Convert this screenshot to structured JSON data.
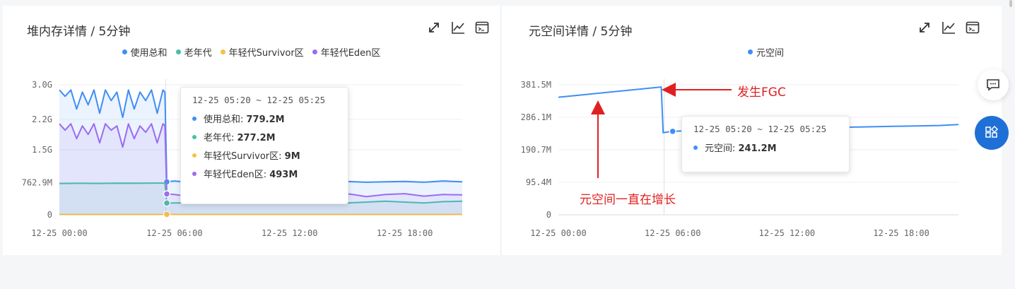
{
  "heap_panel": {
    "title": "堆内存详情 / 5分钟",
    "tooltip": {
      "time": "12-25 05:20 ~ 12-25 05:25",
      "rows": [
        {
          "label": "使用总和:",
          "value": "779.2M",
          "color": "#3f8ef5"
        },
        {
          "label": "老年代:",
          "value": "277.2M",
          "color": "#45c1a4"
        },
        {
          "label": "年轻代Survivor区:",
          "value": "9M",
          "color": "#f5c242"
        },
        {
          "label": "年轻代Eden区:",
          "value": "493M",
          "color": "#9b6cf0"
        }
      ]
    }
  },
  "meta_panel": {
    "title": "元空间详情 / 5分钟",
    "tooltip": {
      "time": "12-25 05:20 ~ 12-25 05:25",
      "rows": [
        {
          "label": "元空间:",
          "value": "241.2M",
          "color": "#3f8ef5"
        }
      ]
    }
  },
  "annotations": {
    "fgc": "发生FGC",
    "growth": "元空间一直在增长"
  },
  "icons": [
    "expand-icon",
    "line-chart-icon",
    "console-icon",
    "comment-icon",
    "apps-icon"
  ],
  "chart_data": [
    {
      "type": "line",
      "title": "堆内存详情 / 5分钟",
      "x_ticks": [
        "12-25 00:00",
        "12-25 06:00",
        "12-25 12:00",
        "12-25 18:00"
      ],
      "y_ticks": [
        "3.0G",
        "2.2G",
        "1.5G",
        "762.9M",
        "0"
      ],
      "y_tick_values_mb": [
        3072,
        2253,
        1536,
        762.9,
        0
      ],
      "ylim_mb": [
        0,
        3072
      ],
      "x_unit": "hours since 12-25 00:00",
      "xlim": [
        0,
        21
      ],
      "legend_position": "top",
      "grid": true,
      "series": [
        {
          "name": "使用总和",
          "color": "#3f8ef5",
          "x": [
            0,
            0.3,
            0.6,
            0.9,
            1.2,
            1.5,
            1.8,
            2.1,
            2.4,
            2.7,
            3.0,
            3.3,
            3.6,
            3.9,
            4.2,
            4.5,
            4.8,
            5.1,
            5.4,
            5.5,
            5.6,
            6,
            7,
            8,
            9,
            10,
            11,
            12,
            13,
            14,
            15,
            16,
            17,
            18,
            19,
            20,
            21
          ],
          "y": [
            2950,
            2800,
            2950,
            2500,
            2900,
            2600,
            2950,
            2400,
            2950,
            2700,
            2900,
            2300,
            2950,
            2500,
            2900,
            2700,
            2950,
            2400,
            2950,
            2900,
            779.2,
            800,
            760,
            790,
            770,
            780,
            760,
            790,
            770,
            780,
            790,
            770,
            780,
            790,
            770,
            800,
            780
          ]
        },
        {
          "name": "老年代",
          "color": "#45c1a4",
          "x": [
            0,
            1,
            2,
            3,
            4,
            5,
            5.5,
            5.6,
            6,
            7,
            8,
            9,
            10,
            11,
            12,
            13,
            14,
            15,
            16,
            17,
            18,
            19,
            20,
            21
          ],
          "y": [
            740,
            745,
            742,
            748,
            745,
            750,
            750,
            277.2,
            280,
            285,
            290,
            300,
            310,
            320,
            300,
            290,
            300,
            280,
            300,
            320,
            300,
            280,
            310,
            320
          ]
        },
        {
          "name": "年轻代Survivor区",
          "color": "#f5c242",
          "x": [
            0,
            5.5,
            5.6,
            21
          ],
          "y": [
            9,
            9,
            9,
            9
          ]
        },
        {
          "name": "年轻代Eden区",
          "color": "#9b6cf0",
          "x": [
            0,
            0.3,
            0.6,
            0.9,
            1.2,
            1.5,
            1.8,
            2.1,
            2.4,
            2.7,
            3.0,
            3.3,
            3.6,
            3.9,
            4.2,
            4.5,
            4.8,
            5.1,
            5.4,
            5.5,
            5.6,
            6,
            7,
            8,
            9,
            10,
            11,
            12,
            13,
            14,
            15,
            16,
            17,
            18,
            19,
            20,
            21
          ],
          "y": [
            2150,
            2000,
            2150,
            1800,
            2100,
            1900,
            2150,
            1700,
            2150,
            2000,
            2100,
            1600,
            2150,
            1800,
            2100,
            1950,
            2150,
            1700,
            2150,
            2100,
            493,
            480,
            420,
            500,
            450,
            480,
            430,
            500,
            440,
            470,
            500,
            430,
            480,
            500,
            440,
            480,
            470
          ]
        }
      ]
    },
    {
      "type": "line",
      "title": "元空间详情 / 5分钟",
      "x_ticks": [
        "12-25 00:00",
        "12-25 06:00",
        "12-25 12:00",
        "12-25 18:00"
      ],
      "y_ticks": [
        "381.5M",
        "286.1M",
        "190.7M",
        "95.4M",
        "0"
      ],
      "y_tick_values_mb": [
        381.5,
        286.1,
        190.7,
        95.4,
        0
      ],
      "ylim_mb": [
        0,
        381.5
      ],
      "x_unit": "hours since 12-25 00:00",
      "xlim": [
        0,
        21
      ],
      "legend_position": "top",
      "grid": true,
      "series": [
        {
          "name": "元空间",
          "color": "#3f8ef5",
          "x": [
            0,
            5.4,
            5.5,
            6,
            8,
            10,
            12,
            14,
            16,
            18,
            20,
            21
          ],
          "y": [
            345,
            375,
            241.2,
            245,
            248,
            252,
            254,
            256,
            258,
            260,
            262,
            265
          ]
        }
      ]
    }
  ]
}
